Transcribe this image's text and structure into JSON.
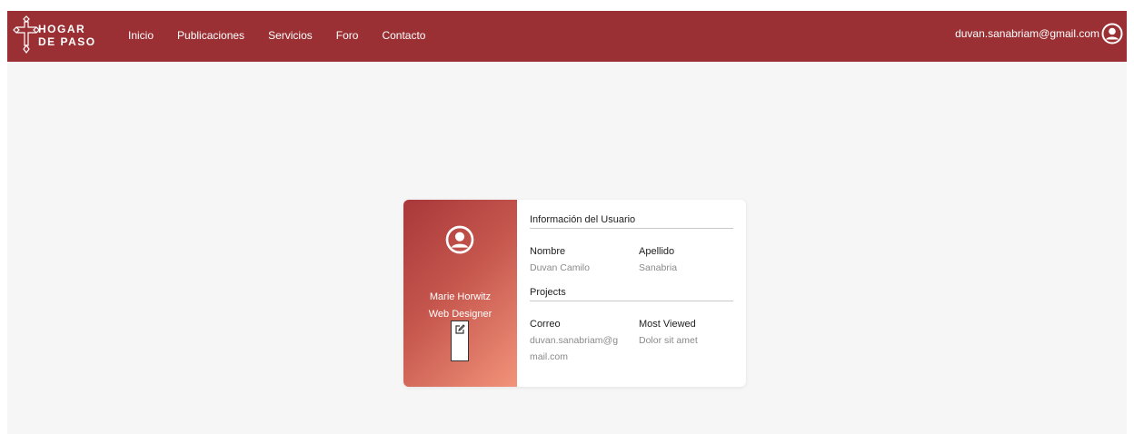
{
  "brand": {
    "line1": "HOGAR",
    "line2": "DE PASO",
    "color": "#9a3034"
  },
  "nav": {
    "items": [
      "Inicio",
      "Publicaciones",
      "Servicios",
      "Foro",
      "Contacto"
    ]
  },
  "user": {
    "email": "duvan.sanabriam@gmail.com",
    "icon": "user-circle-icon"
  },
  "profile": {
    "name": "Marie Horwitz",
    "role": "Web Designer",
    "avatar_icon": "user-circle-icon",
    "edit_icon": "edit-icon",
    "gradient": [
      "#a8383a",
      "#f2937a"
    ]
  },
  "info": {
    "section1_title": "Información del Usuario",
    "nombre_label": "Nombre",
    "nombre_value": "Duvan Camilo",
    "apellido_label": "Apellido",
    "apellido_value": "Sanabria",
    "section2_title": "Projects",
    "correo_label": "Correo",
    "correo_value_line1": "duvan.sanabriam@g",
    "correo_value_line2": "mail.com",
    "most_viewed_label": "Most Viewed",
    "most_viewed_value": "Dolor sit amet"
  }
}
